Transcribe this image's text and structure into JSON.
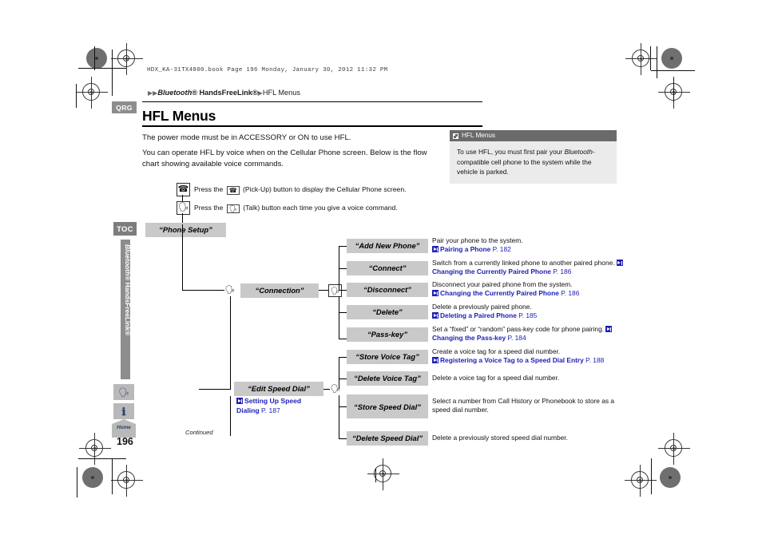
{
  "header": {
    "file_stamp": "HDX_KA-31TX4800.book  Page 196  Monday, January 30, 2012  11:32 PM",
    "breadcrumb_1": "Bluetooth®",
    "breadcrumb_2": "HandsFreeLink®",
    "breadcrumb_3": "HFL Menus",
    "title": "HFL Menus"
  },
  "body": {
    "paragraph_1": "The power mode must be in ACCESSORY or ON to use HFL.",
    "paragraph_2": "You can operate HFL by voice when on the Cellular Phone screen. Below is the flow chart showing available voice commands."
  },
  "callout": {
    "heading": "HFL Menus",
    "text_a": "To use HFL, you must first pair your ",
    "text_italic": "Bluetooth-",
    "text_b": "compatible cell phone to the system while the vehicle is parked."
  },
  "instructions": [
    {
      "text_a": "Press the ",
      "icon": "pickup-icon",
      "text_b": " (Pick-Up) button to display the Cellular Phone screen."
    },
    {
      "text_a": "Press the ",
      "icon": "talk-icon",
      "text_b": " (Talk) button each time you give a voice command."
    }
  ],
  "flow": {
    "root": "“Phone Setup”",
    "branch_connection": "“Connection”",
    "branch_edit_speed_dial": "“Edit Speed Dial”",
    "edit_speed_dial_note": "Setting Up Speed Dialing",
    "edit_speed_dial_note_page": "P. 187",
    "continued": "Continued",
    "items": [
      {
        "label": "“Add New Phone”",
        "desc": "Pair your phone to the system.",
        "link": "Pairing a Phone",
        "page": "P. 182",
        "inline": false
      },
      {
        "label": "“Connect”",
        "desc": "Switch from a currently linked phone to another paired phone.",
        "link": "Changing the Currently Paired Phone",
        "page": "P. 186",
        "inline": true
      },
      {
        "label": "“Disconnect”",
        "desc": "Disconnect your paired phone from the system.",
        "link": "Changing the Currently Paired Phone",
        "page": "P. 186",
        "inline": false
      },
      {
        "label": "“Delete”",
        "desc": "Delete a previously paired phone.",
        "link": "Deleting a Paired Phone",
        "page": "P. 185",
        "inline": false
      },
      {
        "label": "“Pass-key”",
        "desc": "Set a “fixed” or “random” pass-key code for phone pairing.",
        "link": "Changing the Pass-key",
        "page": "P. 184",
        "inline": true
      },
      {
        "label": "“Store Voice Tag”",
        "desc": "Create a voice tag for a speed dial number.",
        "link": "Registering a Voice Tag to a Speed Dial Entry",
        "page": "P. 188",
        "inline": false
      },
      {
        "label": "“Delete Voice Tag”",
        "desc": "Delete a voice tag for a speed dial number.",
        "link": "",
        "page": "",
        "inline": false
      },
      {
        "label": "“Store Speed Dial”",
        "desc": "Select a number from Call History or Phonebook to store as a speed dial number.",
        "link": "",
        "page": "",
        "inline": false
      },
      {
        "label": "“Delete Speed Dial”",
        "desc": "Delete a previously stored speed dial number.",
        "link": "",
        "page": "",
        "inline": false
      }
    ]
  },
  "sidebar": {
    "tab_qrg": "QRG",
    "tab_toc": "TOC",
    "vertical_label_a": "Bluetooth®",
    "vertical_label_b": " HandsFreeLink®",
    "icon_voice": "talk-icon",
    "icon_info": "info-icon",
    "icon_home": "Home",
    "page_number": "196"
  },
  "colors": {
    "box_gray": "#c9c9c9",
    "tab_gray": "#8d8d8d",
    "link_blue": "#1f21b5",
    "callout_head": "#6a6a6a",
    "callout_body": "#ebebeb"
  }
}
